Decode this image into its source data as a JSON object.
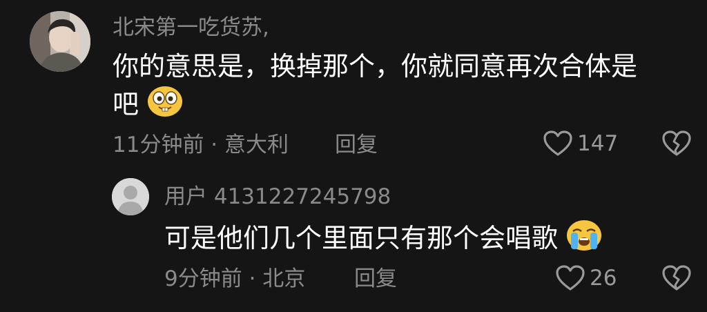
{
  "comments": [
    {
      "username": "北宋第一吃货苏,",
      "text_line1": "你的意思是，换掉那个，你就同意再次合体是",
      "text_line2": "吧",
      "emoji": "goofy-face-emoji",
      "time_location": "11分钟前 · 意大利",
      "reply_label": "回复",
      "likes": "147"
    },
    {
      "username": "用户 4131227245798",
      "text": "可是他们几个里面只有那个会唱歌",
      "emoji": "crying-face-emoji",
      "time_location": "9分钟前 · 北京",
      "reply_label": "回复",
      "likes": "26"
    }
  ],
  "icons": {
    "like": "heart-outline-icon",
    "dislike": "broken-heart-icon"
  },
  "colors": {
    "background": "#151515",
    "text": "#ffffff",
    "muted": "#8a8a8a"
  }
}
